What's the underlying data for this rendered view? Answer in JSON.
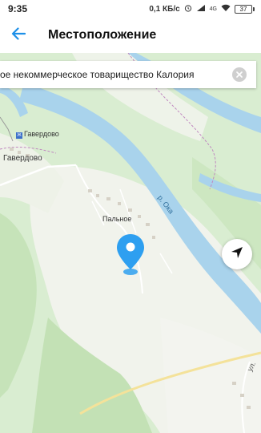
{
  "status_bar": {
    "time": "9:35",
    "network_speed": "0,1 КБ/с",
    "signal_label": "4G",
    "battery": "37"
  },
  "header": {
    "back_icon": "arrow-back-icon",
    "title": "Местоположение"
  },
  "search": {
    "value": "ое некоммерческое товарищество Калория",
    "clear_icon": "close-icon"
  },
  "map": {
    "labels": {
      "village_station": "Гавердово",
      "village": "Гавердово",
      "settlement": "Пальное",
      "river": "р. Ока",
      "road": "ул."
    },
    "locate_icon": "navigation-arrow-icon",
    "pin_icon": "map-pin-icon",
    "colors": {
      "water": "#a9d3ec",
      "forest": "#cfe8c4",
      "field": "#f2f4ee",
      "pin": "#2e9ff0"
    }
  }
}
